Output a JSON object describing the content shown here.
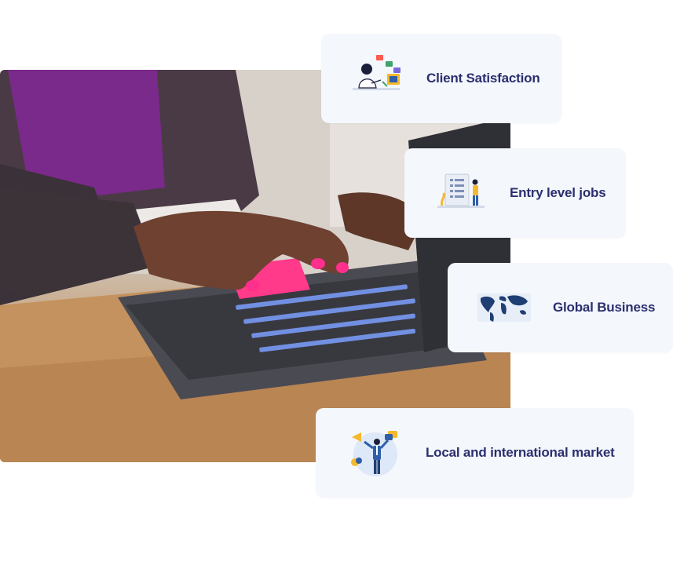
{
  "photo": {
    "subject": "hands-typing-on-laptop"
  },
  "features": [
    {
      "label": "Client Satisfaction",
      "icon": "client-satisfaction-illustration"
    },
    {
      "label": "Entry level jobs",
      "icon": "entry-level-jobs-illustration"
    },
    {
      "label": "Global Business",
      "icon": "world-map-illustration"
    },
    {
      "label": "Local and international market",
      "icon": "market-businessman-illustration"
    }
  ],
  "colors": {
    "card_bg": "#f4f7fc",
    "label": "#2b2f6e",
    "accent_blue": "#2f5fa8",
    "accent_yellow": "#f5b82e"
  }
}
